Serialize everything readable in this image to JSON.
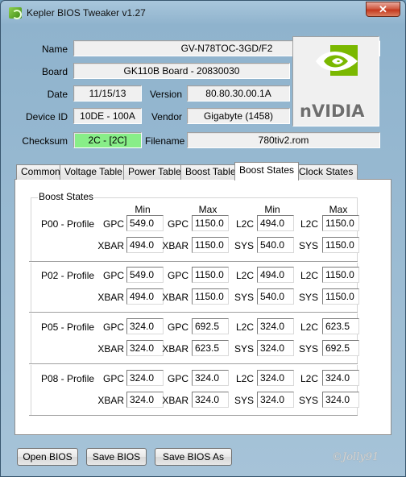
{
  "window": {
    "title": "Kepler BIOS Tweaker v1.27",
    "close_label": "✕"
  },
  "info": {
    "name_label": "Name",
    "name_value": "GV-N78TOC-3GD/F2",
    "board_label": "Board",
    "board_value": "GK110B Board - 20830030",
    "date_label": "Date",
    "date_value": "11/15/13",
    "version_label": "Version",
    "version_value": "80.80.30.00.1A",
    "device_label": "Device ID",
    "device_value": "10DE - 100A",
    "vendor_label": "Vendor",
    "vendor_value": "Gigabyte (1458)",
    "checksum_label": "Checksum",
    "checksum_value": "2C - [2C]",
    "filename_label": "Filename",
    "filename_value": "780tiv2.rom"
  },
  "logo": {
    "text_main": "nVIDIA",
    "colors": {
      "green": "#7ab800",
      "gray": "#6e6e6e"
    }
  },
  "tabs": [
    "Common",
    "Voltage Table",
    "Power Table",
    "Boost Table",
    "Boost States",
    "Clock States"
  ],
  "active_tab": "Boost States",
  "boost": {
    "group_title": "Boost States",
    "headers": [
      "Min",
      "Max",
      "Min",
      "Max"
    ],
    "profiles": [
      {
        "name": "P00 - Profile",
        "row1": [
          {
            "l": "GPC",
            "v": "549.0"
          },
          {
            "l": "GPC",
            "v": "1150.0"
          },
          {
            "l": "L2C",
            "v": "494.0"
          },
          {
            "l": "L2C",
            "v": "1150.0"
          }
        ],
        "row2": [
          {
            "l": "XBAR",
            "v": "494.0"
          },
          {
            "l": "XBAR",
            "v": "1150.0"
          },
          {
            "l": "SYS",
            "v": "540.0"
          },
          {
            "l": "SYS",
            "v": "1150.0"
          }
        ]
      },
      {
        "name": "P02 - Profile",
        "row1": [
          {
            "l": "GPC",
            "v": "549.0"
          },
          {
            "l": "GPC",
            "v": "1150.0"
          },
          {
            "l": "L2C",
            "v": "494.0"
          },
          {
            "l": "L2C",
            "v": "1150.0"
          }
        ],
        "row2": [
          {
            "l": "XBAR",
            "v": "494.0"
          },
          {
            "l": "XBAR",
            "v": "1150.0"
          },
          {
            "l": "SYS",
            "v": "540.0"
          },
          {
            "l": "SYS",
            "v": "1150.0"
          }
        ]
      },
      {
        "name": "P05 - Profile",
        "row1": [
          {
            "l": "GPC",
            "v": "324.0"
          },
          {
            "l": "GPC",
            "v": "692.5"
          },
          {
            "l": "L2C",
            "v": "324.0"
          },
          {
            "l": "L2C",
            "v": "623.5"
          }
        ],
        "row2": [
          {
            "l": "XBAR",
            "v": "324.0"
          },
          {
            "l": "XBAR",
            "v": "623.5"
          },
          {
            "l": "SYS",
            "v": "324.0"
          },
          {
            "l": "SYS",
            "v": "692.5"
          }
        ]
      },
      {
        "name": "P08 - Profile",
        "row1": [
          {
            "l": "GPC",
            "v": "324.0"
          },
          {
            "l": "GPC",
            "v": "324.0"
          },
          {
            "l": "L2C",
            "v": "324.0"
          },
          {
            "l": "L2C",
            "v": "324.0"
          }
        ],
        "row2": [
          {
            "l": "XBAR",
            "v": "324.0"
          },
          {
            "l": "XBAR",
            "v": "324.0"
          },
          {
            "l": "SYS",
            "v": "324.0"
          },
          {
            "l": "SYS",
            "v": "324.0"
          }
        ]
      }
    ]
  },
  "buttons": {
    "open": "Open BIOS",
    "save": "Save BIOS",
    "save_as": "Save BIOS As"
  },
  "watermark": "©Jolly91"
}
